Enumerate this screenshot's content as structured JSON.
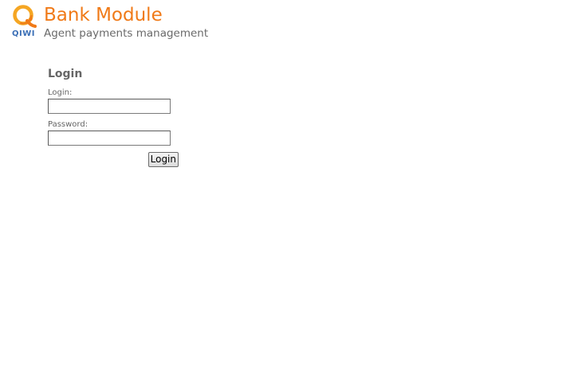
{
  "header": {
    "logo_text": "QIWI",
    "title": "Bank Module",
    "subtitle": "Agent payments management"
  },
  "login_form": {
    "title": "Login",
    "login_label": "Login:",
    "login_value": "",
    "password_label": "Password:",
    "password_value": "",
    "submit_label": "Login"
  },
  "colors": {
    "brand_orange": "#f07a18",
    "brand_blue": "#3b6fb6",
    "text_gray": "#666666"
  }
}
